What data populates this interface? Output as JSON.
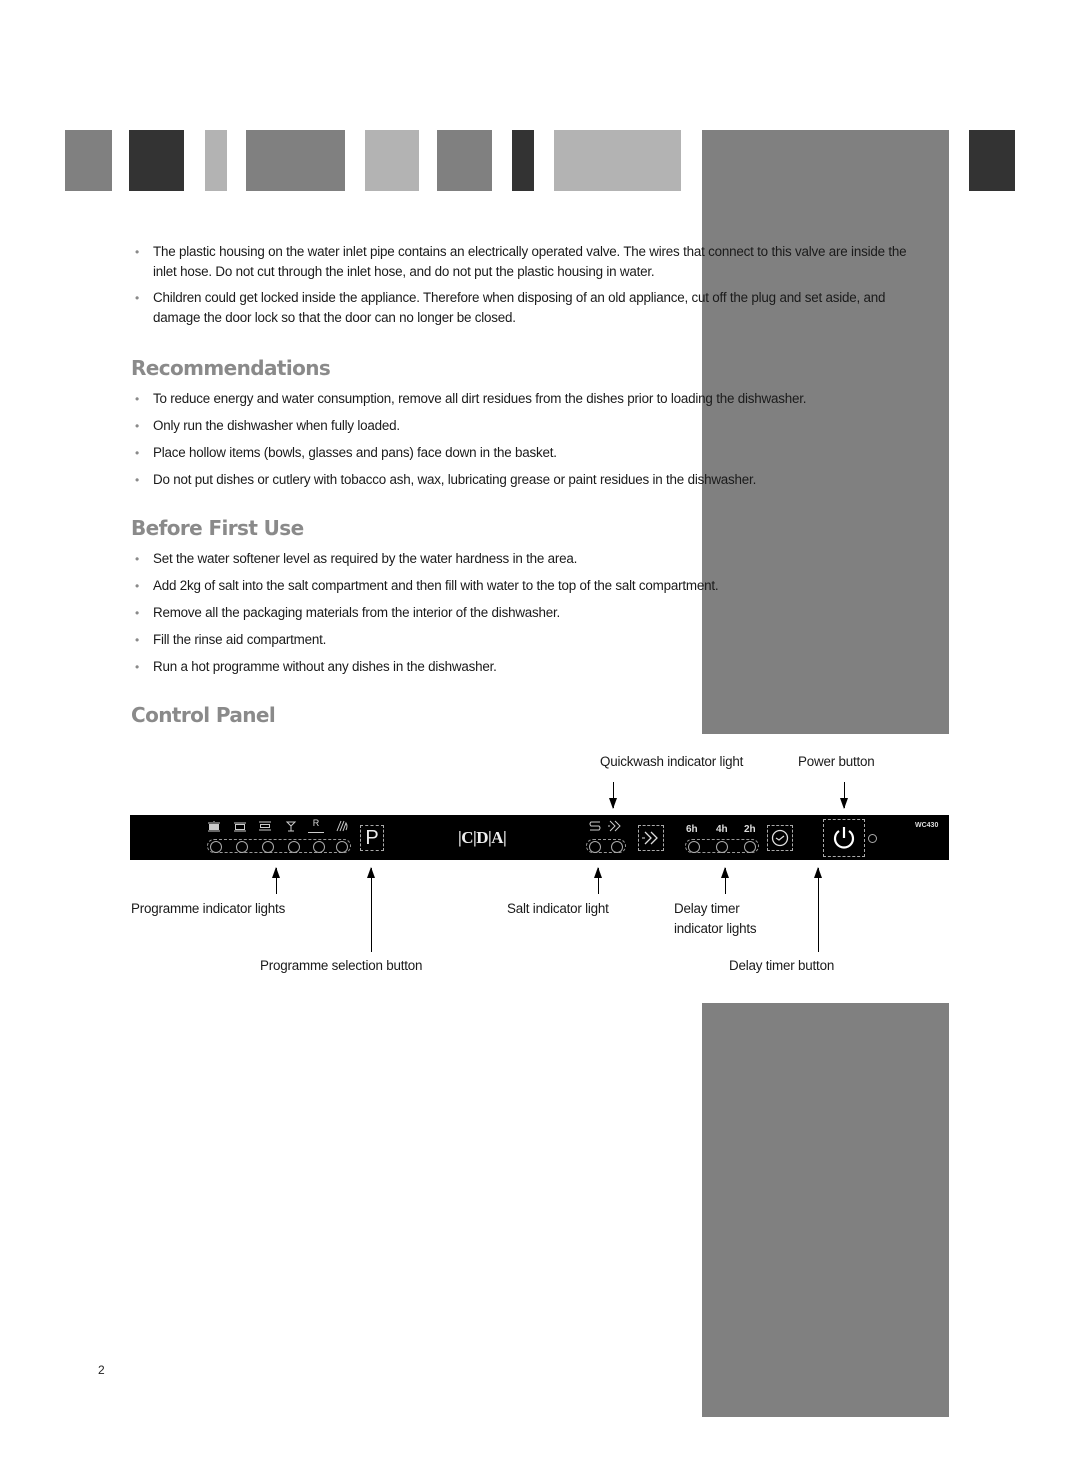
{
  "sections": {
    "warnings": {
      "items": [
        "The plastic housing on the water inlet pipe contains an electrically operated valve.  The wires that connect to this valve are inside the inlet hose. Do not cut through the inlet hose, and do not put the plastic housing in water.",
        "Children could get locked inside the appliance. Therefore when disposing of an old appliance, cut off the plug and set aside, and damage the door lock so that the door can no longer be closed."
      ]
    },
    "recommendations": {
      "title": "Recommendations",
      "items": [
        "To reduce energy and water consumption, remove all dirt residues from the dishes prior to loading the dishwasher.",
        "Only run the dishwasher when fully loaded.",
        "Place hollow items (bowls, glasses and pans) face down in the basket.",
        "Do not put dishes or cutlery with tobacco ash, wax, lubricating grease or paint residues in the dishwasher."
      ]
    },
    "before_first_use": {
      "title": "Before First Use",
      "items": [
        "Set the water softener level as required by the water hardness in the area.",
        "Add 2kg of salt into the salt compartment and then fill with water to the top of the salt compartment.",
        "Remove all the packaging materials from the interior of the dishwasher.",
        "Fill the rinse aid compartment.",
        "Run a hot programme without any dishes in the dishwasher."
      ]
    },
    "control_panel": {
      "title": "Control Panel",
      "panel": {
        "brand": "|C|D|A|",
        "model": "WC430",
        "programme_button": "P",
        "delay_labels": [
          "6h",
          "4h",
          "2h"
        ],
        "programme_icons": [
          "intensive-pot-icon",
          "normal-pot-icon",
          "eco-plates-icon",
          "glass-icon",
          "rinse-icon",
          "quick-wash-icon"
        ],
        "rinse_glyph": "R"
      },
      "labels": {
        "quickwash": "Quickwash indicator light",
        "power": "Power button",
        "programme_lights": "Programme indicator lights",
        "programme_button": "Programme selection button",
        "salt": "Salt indicator light",
        "delay_lights_1": "Delay timer",
        "delay_lights_2": "indicator lights",
        "delay_button": "Delay timer button"
      }
    }
  },
  "page_number": "2",
  "colors": {
    "heading": "#8a8a8a",
    "tab_mid": "#808080",
    "tab_dark": "#333333",
    "tab_light": "#b3b3b3"
  }
}
